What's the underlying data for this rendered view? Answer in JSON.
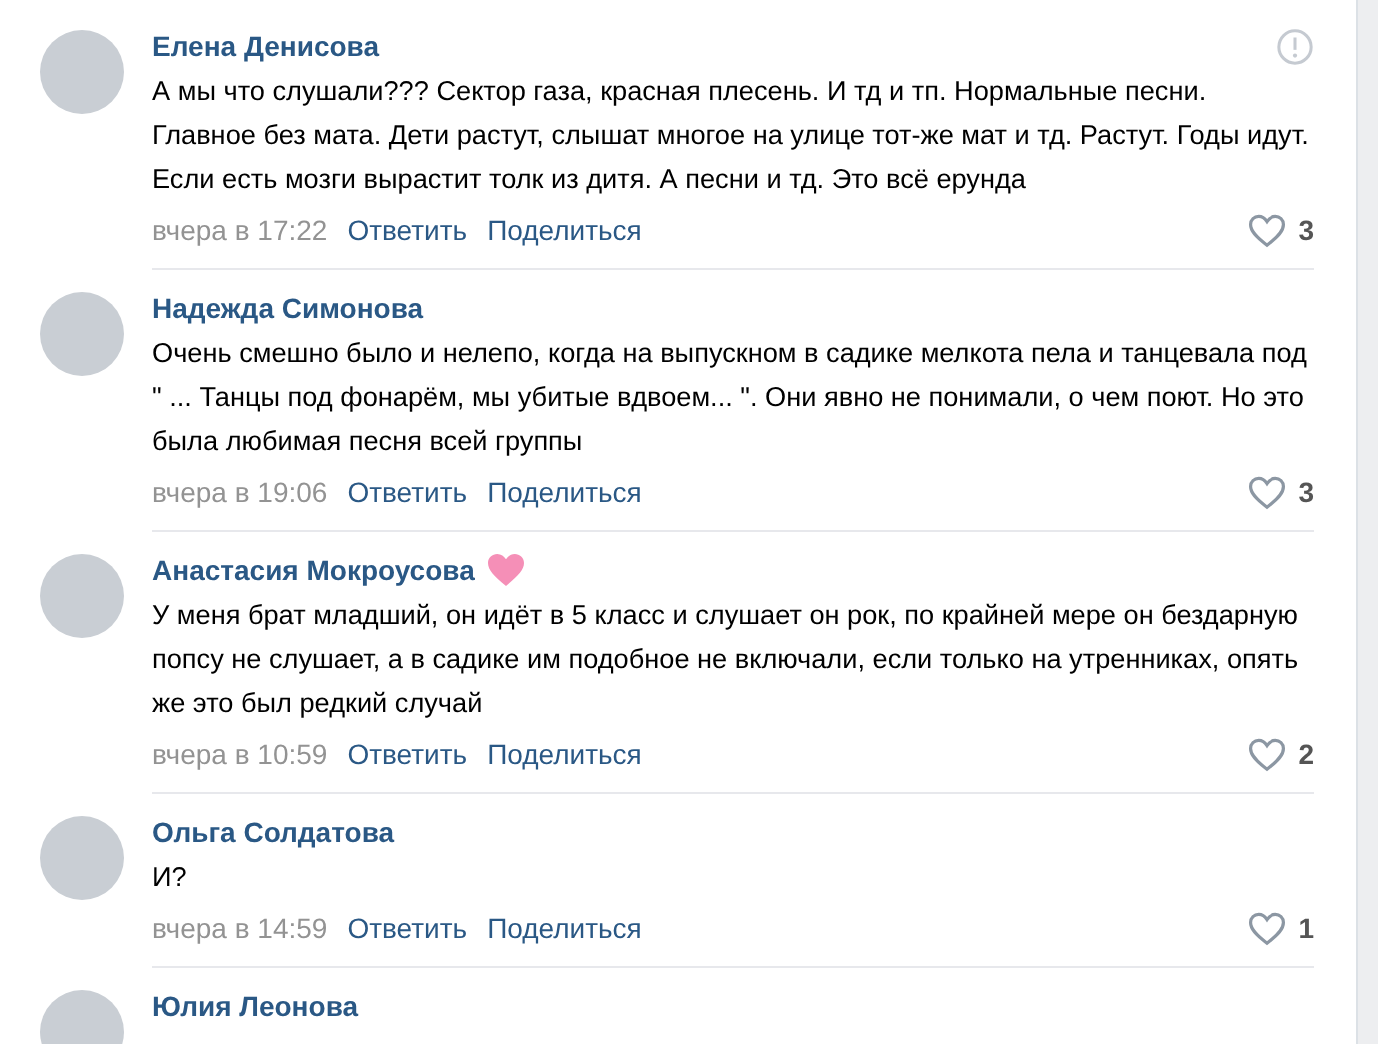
{
  "comments": [
    {
      "author": "Елена Денисова",
      "badge": false,
      "report": true,
      "text": "А мы что слушали??? Сектор газа, красная плесень. И тд и тп. Нормальные песни. Главное без мата. Дети растут, слышат многое на улице тот-же мат и тд. Растут. Годы идут. Если есть мозги вырастит толк из дитя. А песни и тд. Это всё ерунда",
      "time": "вчера в 17:22",
      "reply": "Ответить",
      "share": "Поделиться",
      "likes": "3"
    },
    {
      "author": "Надежда Симонова",
      "badge": false,
      "report": false,
      "text": "Очень смешно было и нелепо, когда на выпускном в садике мелкота пела и танцевала под \" ... Танцы под фонарём, мы убитые вдвоем... \". Они явно не понимали, о чем поют. Но это была любимая песня всей группы",
      "time": "вчера в 19:06",
      "reply": "Ответить",
      "share": "Поделиться",
      "likes": "3"
    },
    {
      "author": "Анастасия Мокроусова",
      "badge": true,
      "report": false,
      "text": "У меня брат младший, он идёт в 5 класс и слушает он рок, по крайней мере он бездарную попсу не слушает, а в садике им подобное не включали, если только на утренниках, опять же это был редкий случай",
      "time": "вчера в 10:59",
      "reply": "Ответить",
      "share": "Поделиться",
      "likes": "2"
    },
    {
      "author": "Ольга Солдатова",
      "badge": false,
      "report": false,
      "text": "И?",
      "time": "вчера в 14:59",
      "reply": "Ответить",
      "share": "Поделиться",
      "likes": "1"
    },
    {
      "author": "Юлия Леонова",
      "badge": false,
      "report": false
    }
  ]
}
